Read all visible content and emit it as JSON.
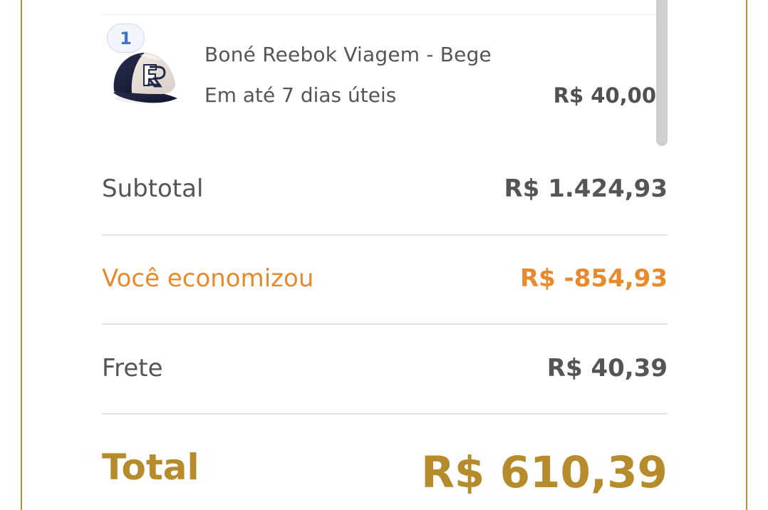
{
  "cart": {
    "item": {
      "quantity": "1",
      "name": "Boné Reebok Viagem - Bege",
      "delivery": "Em até 7 dias úteis",
      "price": "R$ 40,00",
      "image_icon": "cap-product-image"
    }
  },
  "summary": {
    "subtotal_label": "Subtotal",
    "subtotal_value": "R$ 1.424,93",
    "savings_label": "Você economizou",
    "savings_value": "R$ -854,93",
    "shipping_label": "Frete",
    "shipping_value": "R$ 40,39",
    "total_label": "Total",
    "total_value": "R$ 610,39"
  },
  "colors": {
    "border": "#b8912f",
    "accent": "#e78a2d",
    "total": "#b58b2c",
    "badge": "#3d73c9"
  }
}
